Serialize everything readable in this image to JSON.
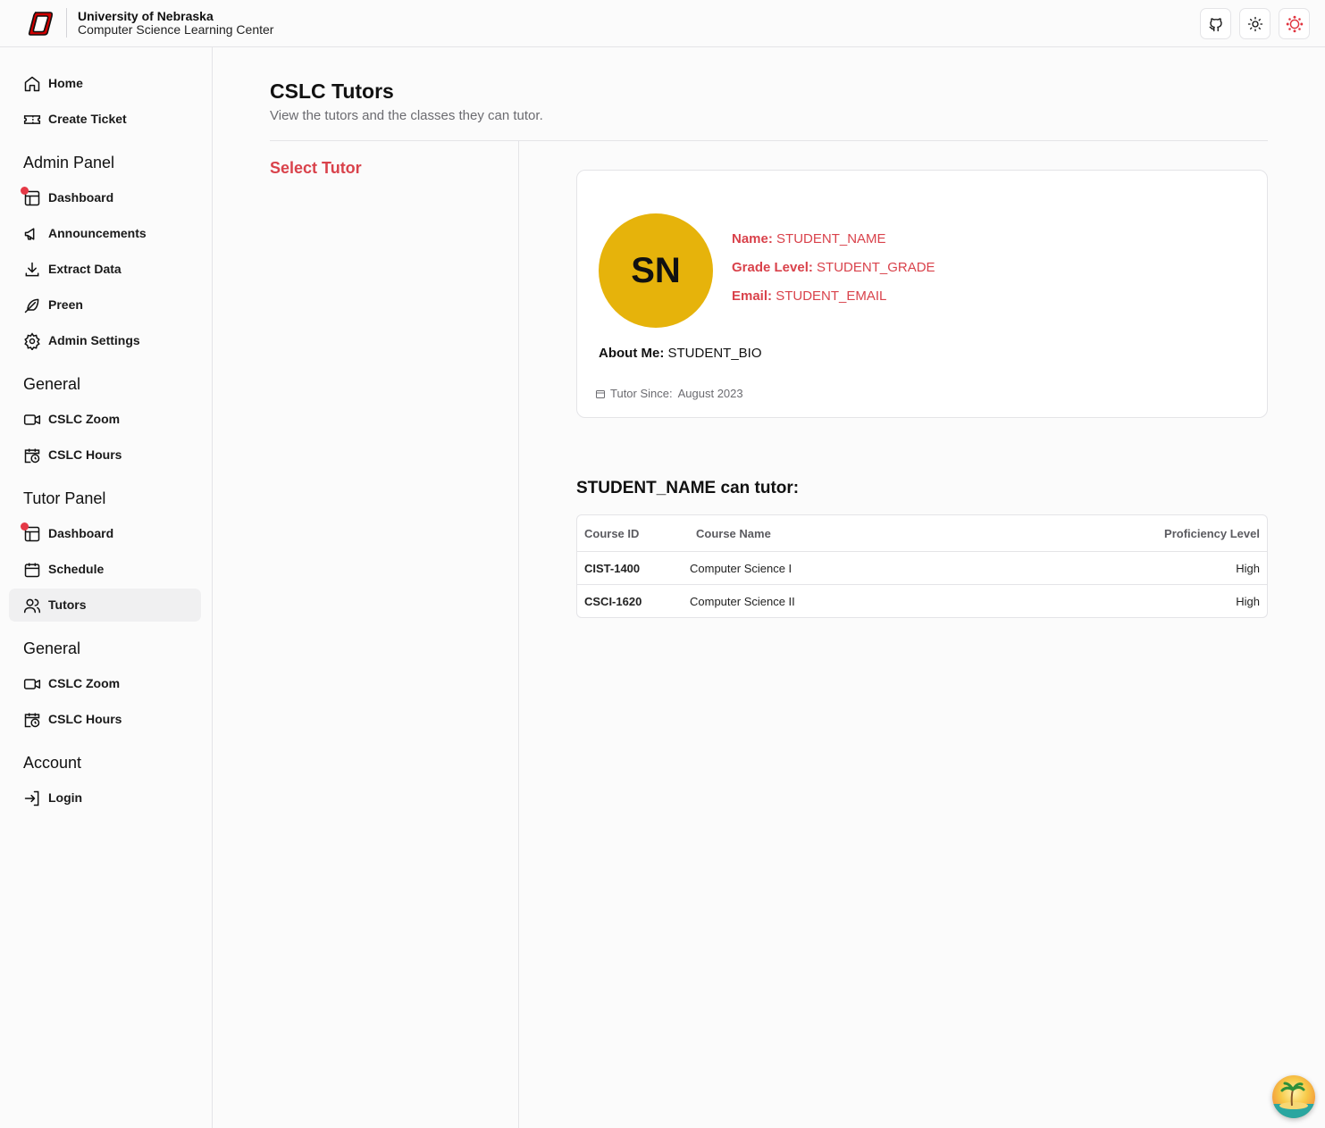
{
  "header": {
    "brand_line1": "University of Nebraska",
    "brand_line2": "Computer Science Learning Center",
    "icons": [
      "github-icon",
      "sun-icon",
      "canvas-icon"
    ]
  },
  "sidebar": {
    "top_items": [
      {
        "label": "Home",
        "icon": "home-icon"
      },
      {
        "label": "Create Ticket",
        "icon": "ticket-icon"
      }
    ],
    "admin_panel": {
      "title": "Admin Panel",
      "items": [
        {
          "label": "Dashboard",
          "icon": "dashboard-icon",
          "notification": true
        },
        {
          "label": "Announcements",
          "icon": "megaphone-icon"
        },
        {
          "label": "Extract Data",
          "icon": "download-icon"
        },
        {
          "label": "Preen",
          "icon": "feather-icon"
        },
        {
          "label": "Admin Settings",
          "icon": "gear-icon"
        }
      ]
    },
    "general_1": {
      "title": "General",
      "items": [
        {
          "label": "CSLC Zoom",
          "icon": "video-icon"
        },
        {
          "label": "CSLC Hours",
          "icon": "calendar-clock-icon"
        }
      ]
    },
    "tutor_panel": {
      "title": "Tutor Panel",
      "items": [
        {
          "label": "Dashboard",
          "icon": "dashboard-icon",
          "notification": true
        },
        {
          "label": "Schedule",
          "icon": "calendar-icon"
        },
        {
          "label": "Tutors",
          "icon": "users-icon",
          "active": true
        }
      ]
    },
    "general_2": {
      "title": "General",
      "items": [
        {
          "label": "CSLC Zoom",
          "icon": "video-icon"
        },
        {
          "label": "CSLC Hours",
          "icon": "calendar-clock-icon"
        }
      ]
    },
    "account": {
      "title": "Account",
      "items": [
        {
          "label": "Login",
          "icon": "login-icon"
        }
      ]
    }
  },
  "main": {
    "title": "CSLC Tutors",
    "subtitle": "View the tutors and the classes they can tutor.",
    "select_tutor": "Select Tutor",
    "profile": {
      "initials": "SN",
      "name_label": "Name:",
      "name_value": "STUDENT_NAME",
      "grade_label": "Grade Level:",
      "grade_value": "STUDENT_GRADE",
      "email_label": "Email:",
      "email_value": "STUDENT_EMAIL",
      "about_label": "About Me:",
      "about_value": "STUDENT_BIO",
      "since_label": "Tutor Since:",
      "since_value": "August 2023",
      "avatar_color": "#e6b30b"
    },
    "can_tutor_heading": "STUDENT_NAME can tutor:",
    "table": {
      "headers": [
        "Course ID",
        "Course Name",
        "Proficiency Level"
      ],
      "rows": [
        {
          "id": "CIST-1400",
          "name": "Computer Science I",
          "level": "High"
        },
        {
          "id": "CSCI-1620",
          "name": "Computer Science II",
          "level": "High"
        }
      ]
    }
  },
  "colors": {
    "accent_red": "#d9424b",
    "notification_dot": "#e53946",
    "active_bg": "#f0f0f1"
  }
}
